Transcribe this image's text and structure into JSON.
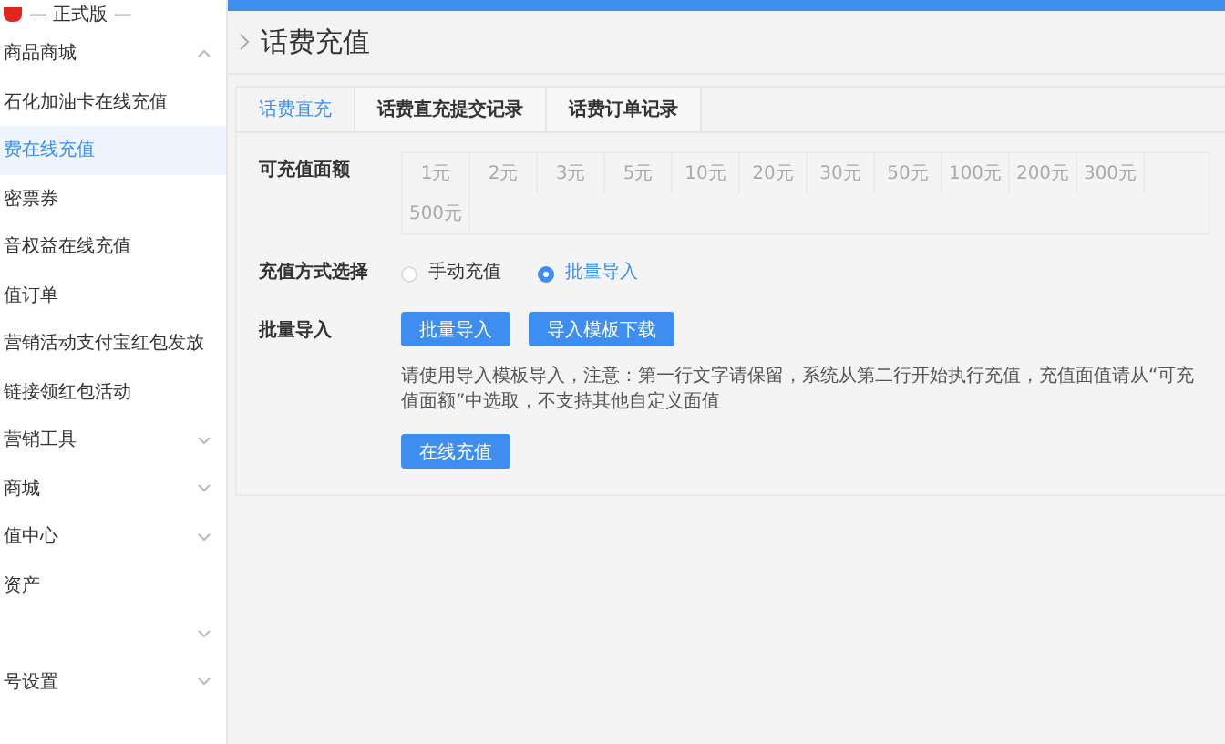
{
  "brand": {
    "edition": "— 正式版 —"
  },
  "sidebar": {
    "items": [
      {
        "kind": "group",
        "label": "商品商城",
        "expanded": true
      },
      {
        "kind": "link",
        "label": "石化加油卡在线充值",
        "selected": false
      },
      {
        "kind": "link",
        "label": "费在线充值",
        "selected": true
      },
      {
        "kind": "link",
        "label": "密票券",
        "selected": false
      },
      {
        "kind": "link",
        "label": "音权益在线充值",
        "selected": false
      },
      {
        "kind": "link",
        "label": "值订单",
        "selected": false
      },
      {
        "kind": "link",
        "label": "营销活动支付宝红包发放",
        "selected": false
      },
      {
        "kind": "link",
        "label": "链接领红包活动",
        "selected": false
      },
      {
        "kind": "group",
        "label": "营销工具",
        "expanded": false
      },
      {
        "kind": "group",
        "label": "商城",
        "expanded": false
      },
      {
        "kind": "group",
        "label": "值中心",
        "expanded": false
      },
      {
        "kind": "link",
        "label": "资产",
        "selected": false
      },
      {
        "kind": "group",
        "expanded": false
      },
      {
        "kind": "group",
        "label": "号设置",
        "expanded": false
      }
    ]
  },
  "page": {
    "title": "话费充值"
  },
  "tabs": [
    {
      "label": "话费直充",
      "selected": true
    },
    {
      "label": "话费直充提交记录",
      "selected": false
    },
    {
      "label": "话费订单记录",
      "selected": false
    }
  ],
  "form": {
    "amount": {
      "label": "可充值面额",
      "options": [
        "1元",
        "2元",
        "3元",
        "5元",
        "10元",
        "20元",
        "30元",
        "50元",
        "100元",
        "200元",
        "300元",
        "500元"
      ]
    },
    "mode": {
      "label": "充值方式选择",
      "options": [
        {
          "label": "手动充值",
          "selected": false
        },
        {
          "label": "批量导入",
          "selected": true
        }
      ]
    },
    "batch": {
      "label": "批量导入",
      "buttons": [
        "批量导入",
        "导入模板下载"
      ],
      "note": "请使用导入模板导入，注意：第一行文字请保留，系统从第二行开始执行充值，充值面值请从“可充值面额”中选取，不支持其他自定义面值"
    },
    "submit": "在线充值"
  }
}
